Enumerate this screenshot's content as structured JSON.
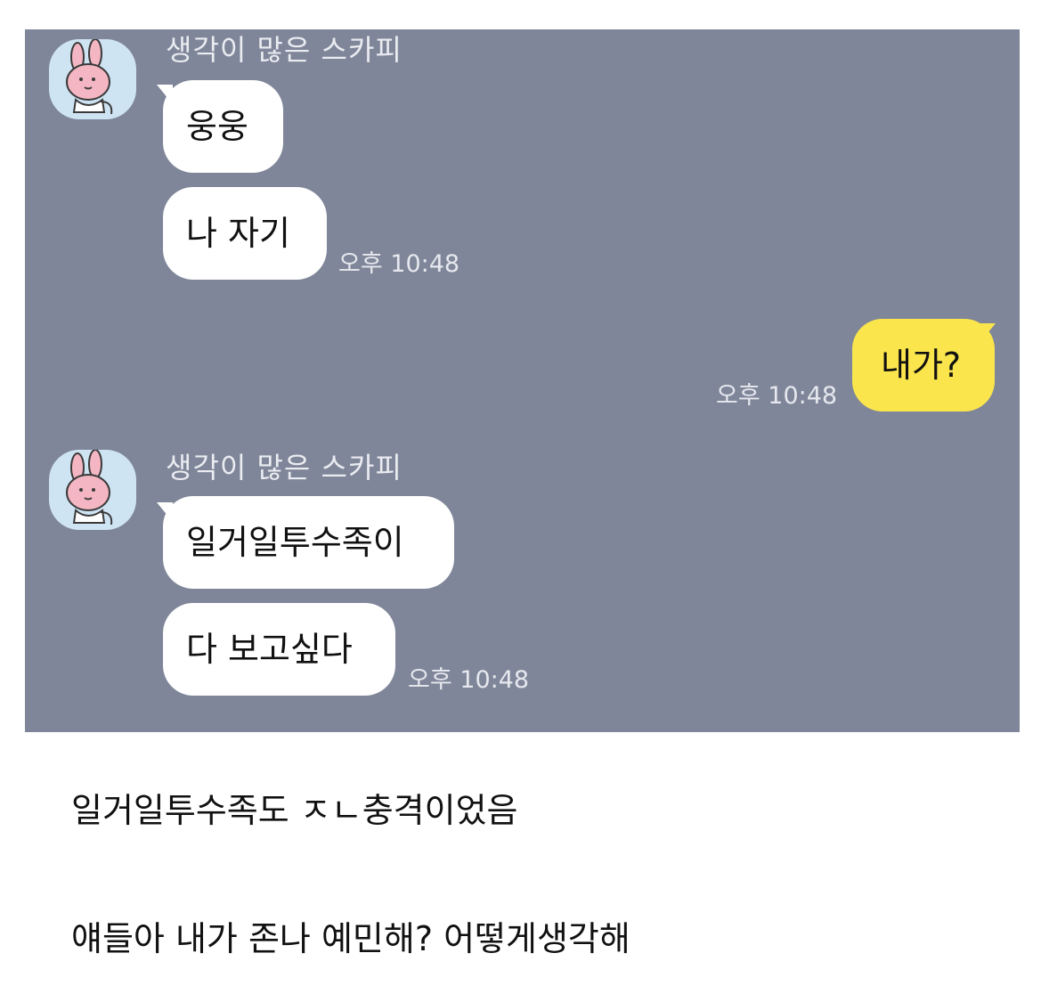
{
  "chat": {
    "messages": [
      {
        "sender": "생각이 많은 스카피",
        "bubbles": [
          "웅웅",
          "나 자기"
        ],
        "time": "오후 10:48"
      },
      {
        "sender": "me",
        "bubbles": [
          "내가?"
        ],
        "time": "오후 10:48"
      },
      {
        "sender": "생각이 많은 스카피",
        "bubbles": [
          "일거일투수족이",
          "다 보고싶다"
        ],
        "time": "오후 10:48"
      }
    ]
  },
  "caption": {
    "line1": "일거일투수족도 ㅈㄴ충격이었음",
    "line2": "얘들아 내가 존나 예민해? 어떻게생각해"
  },
  "colors": {
    "chat_background": "#7f8699",
    "my_bubble": "#fbe54d",
    "their_bubble": "#ffffff"
  }
}
